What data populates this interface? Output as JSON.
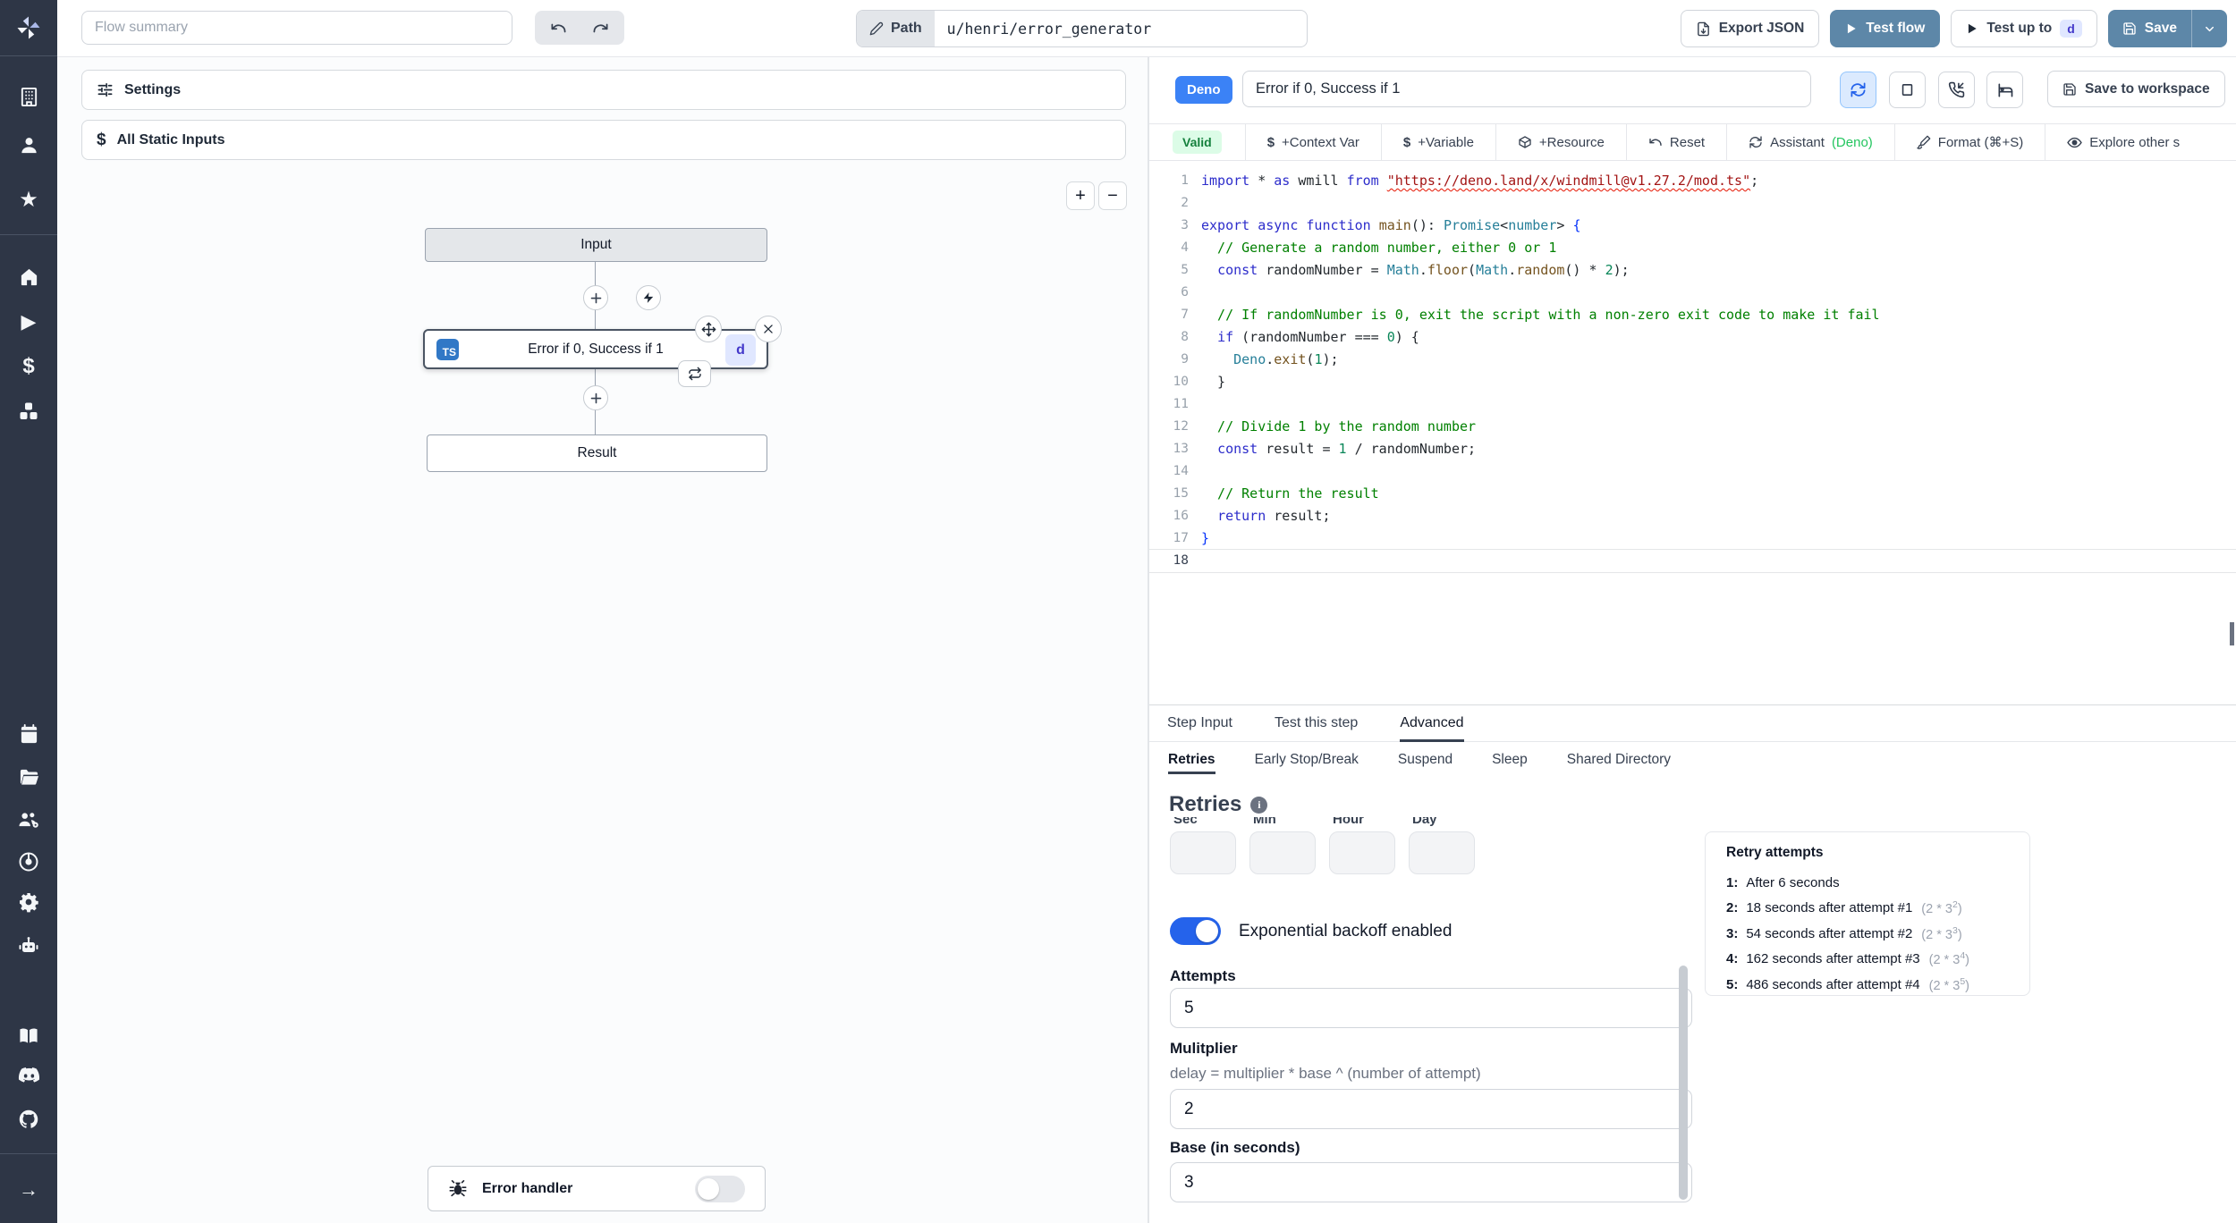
{
  "topbar": {
    "flow_summary_placeholder": "Flow summary",
    "path_label": "Path",
    "path_value": "u/henri/error_generator",
    "export_json": "Export JSON",
    "test_flow": "Test flow",
    "test_up_to": "Test up to",
    "test_up_to_target": "d",
    "save": "Save"
  },
  "sidebar": {
    "icons": [
      "windmill-logo",
      "building",
      "user",
      "star",
      "home",
      "play",
      "dollar",
      "cubes",
      "calendar",
      "folder",
      "users-gear",
      "eye",
      "gear",
      "bot",
      "book",
      "discord",
      "github",
      "arrow-right"
    ]
  },
  "flow": {
    "settings_label": "Settings",
    "static_inputs_label": "All Static Inputs",
    "zoom_in": "+",
    "zoom_out": "−",
    "input_node": "Input",
    "step_node": {
      "lang_badge": "TS",
      "title": "Error if 0, Success if 1",
      "suffix_badge": "d"
    },
    "result_node": "Result",
    "error_handler_label": "Error handler"
  },
  "editor": {
    "lang_badge": "Deno",
    "name_value": "Error if 0, Success if 1",
    "save_to_workspace": "Save to workspace",
    "status": "Valid",
    "actions": {
      "context_var": "+Context Var",
      "variable": "+Variable",
      "resource": "+Resource",
      "reset": "Reset",
      "assistant": "Assistant",
      "assistant_lang": "(Deno)",
      "format": "Format (⌘+S)",
      "explore": "Explore other s"
    },
    "code": {
      "lines": [
        {
          "n": 1,
          "seg": [
            [
              "k",
              "import"
            ],
            [
              "d",
              " * "
            ],
            [
              "k",
              "as"
            ],
            [
              "d",
              " wmill "
            ],
            [
              "k",
              "from"
            ],
            [
              "d",
              " "
            ],
            [
              "u",
              "\"https://deno.land/x/windmill@v1.27.2/mod.ts\""
            ],
            [
              "d",
              ";"
            ]
          ]
        },
        {
          "n": 2,
          "seg": []
        },
        {
          "n": 3,
          "seg": [
            [
              "k",
              "export"
            ],
            [
              "d",
              " "
            ],
            [
              "k",
              "async"
            ],
            [
              "d",
              " "
            ],
            [
              "k",
              "function"
            ],
            [
              "d",
              " "
            ],
            [
              "f",
              "main"
            ],
            [
              "d",
              "(): "
            ],
            [
              "t",
              "Promise"
            ],
            [
              "d",
              "<"
            ],
            [
              "t",
              "number"
            ],
            [
              "d",
              "> "
            ],
            [
              "p",
              "{"
            ]
          ]
        },
        {
          "n": 4,
          "seg": [
            [
              "c",
              "  // Generate a random number, either 0 or 1"
            ]
          ]
        },
        {
          "n": 5,
          "seg": [
            [
              "d",
              "  "
            ],
            [
              "k",
              "const"
            ],
            [
              "d",
              " randomNumber = "
            ],
            [
              "t",
              "Math"
            ],
            [
              "d",
              "."
            ],
            [
              "f",
              "floor"
            ],
            [
              "d",
              "("
            ],
            [
              "t",
              "Math"
            ],
            [
              "d",
              "."
            ],
            [
              "f",
              "random"
            ],
            [
              "d",
              "() * "
            ],
            [
              "n",
              "2"
            ],
            [
              "d",
              ");"
            ]
          ]
        },
        {
          "n": 6,
          "seg": []
        },
        {
          "n": 7,
          "seg": [
            [
              "c",
              "  // If randomNumber is 0, exit the script with a non-zero exit code to make it fail"
            ]
          ]
        },
        {
          "n": 8,
          "seg": [
            [
              "d",
              "  "
            ],
            [
              "k",
              "if"
            ],
            [
              "d",
              " (randomNumber === "
            ],
            [
              "n",
              "0"
            ],
            [
              "d",
              ") {"
            ]
          ]
        },
        {
          "n": 9,
          "seg": [
            [
              "d",
              "    "
            ],
            [
              "t",
              "Deno"
            ],
            [
              "d",
              "."
            ],
            [
              "f",
              "exit"
            ],
            [
              "d",
              "("
            ],
            [
              "n",
              "1"
            ],
            [
              "d",
              ");"
            ]
          ]
        },
        {
          "n": 10,
          "seg": [
            [
              "d",
              "  }"
            ]
          ]
        },
        {
          "n": 11,
          "seg": []
        },
        {
          "n": 12,
          "seg": [
            [
              "c",
              "  // Divide 1 by the random number"
            ]
          ]
        },
        {
          "n": 13,
          "seg": [
            [
              "d",
              "  "
            ],
            [
              "k",
              "const"
            ],
            [
              "d",
              " result = "
            ],
            [
              "n",
              "1"
            ],
            [
              "d",
              " / randomNumber;"
            ]
          ]
        },
        {
          "n": 14,
          "seg": []
        },
        {
          "n": 15,
          "seg": [
            [
              "c",
              "  // Return the result"
            ]
          ]
        },
        {
          "n": 16,
          "seg": [
            [
              "d",
              "  "
            ],
            [
              "k",
              "return"
            ],
            [
              "d",
              " result;"
            ]
          ]
        },
        {
          "n": 17,
          "seg": [
            [
              "p",
              "}"
            ]
          ]
        },
        {
          "n": 18,
          "seg": []
        }
      ],
      "active_line": 18
    }
  },
  "tabs": {
    "items": [
      {
        "label": "Step Input",
        "active": false
      },
      {
        "label": "Test this step",
        "active": false
      },
      {
        "label": "Advanced",
        "active": true
      }
    ],
    "subitems": [
      {
        "label": "Retries",
        "active": true
      },
      {
        "label": "Early Stop/Break",
        "active": false
      },
      {
        "label": "Suspend",
        "active": false
      },
      {
        "label": "Sleep",
        "active": false
      },
      {
        "label": "Shared Directory",
        "active": false
      }
    ]
  },
  "retries": {
    "title": "Retries",
    "time_labels": [
      "Sec",
      "Min",
      "Hour",
      "Day"
    ],
    "time_values": [
      "",
      "",
      "",
      ""
    ],
    "exponential_label": "Exponential backoff enabled",
    "exponential_enabled": true,
    "attempts_label": "Attempts",
    "attempts_value": "5",
    "multiplier_label": "Mulitplier",
    "multiplier_help": "delay = multiplier * base ^ (number of attempt)",
    "multiplier_value": "2",
    "base_label": "Base (in seconds)",
    "base_value": "3"
  },
  "retry_attempts": {
    "title": "Retry attempts",
    "items": [
      {
        "num": "1:",
        "text": "After 6 seconds",
        "formula": null,
        "exp": null
      },
      {
        "num": "2:",
        "text": "18 seconds after attempt #1",
        "formula": "(2 * 3",
        "exp": "2"
      },
      {
        "num": "3:",
        "text": "54 seconds after attempt #2",
        "formula": "(2 * 3",
        "exp": "3"
      },
      {
        "num": "4:",
        "text": "162 seconds after attempt #3",
        "formula": "(2 * 3",
        "exp": "4"
      },
      {
        "num": "5:",
        "text": "486 seconds after attempt #4",
        "formula": "(2 * 3",
        "exp": "5"
      }
    ]
  },
  "colors": {
    "rail_bg": "#2e3646",
    "primary_button": "#5d87a8",
    "deno_badge": "#3b82f6",
    "ts_badge": "#3178c6",
    "toggle_on": "#2563eb",
    "valid_bg": "#dcfce7",
    "valid_text": "#15803d",
    "assistant_green": "#22c55e",
    "d_chip_bg": "#e0e7ff",
    "d_chip_text": "#4338ca"
  }
}
